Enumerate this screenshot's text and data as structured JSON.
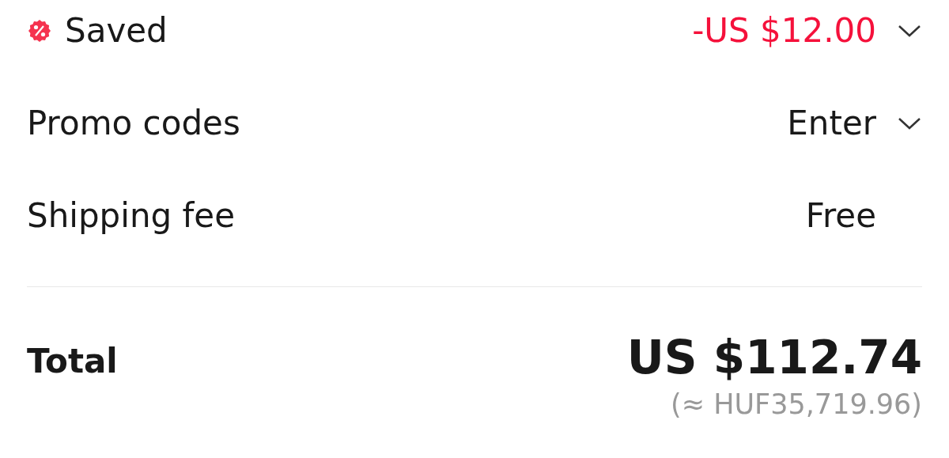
{
  "rows": [
    {
      "kind": "discount",
      "label": "Saved",
      "value": "-US $12.00",
      "highlight": true,
      "expandable": true
    },
    {
      "kind": "plain",
      "label": "Promo codes",
      "value": "Enter",
      "highlight": false,
      "expandable": true
    },
    {
      "kind": "plain",
      "label": "Shipping fee",
      "value": "Free",
      "highlight": false,
      "expandable": false
    }
  ],
  "total": {
    "label": "Total",
    "amount": "US $112.74",
    "converted": "(≈ HUF35,719.96)"
  }
}
